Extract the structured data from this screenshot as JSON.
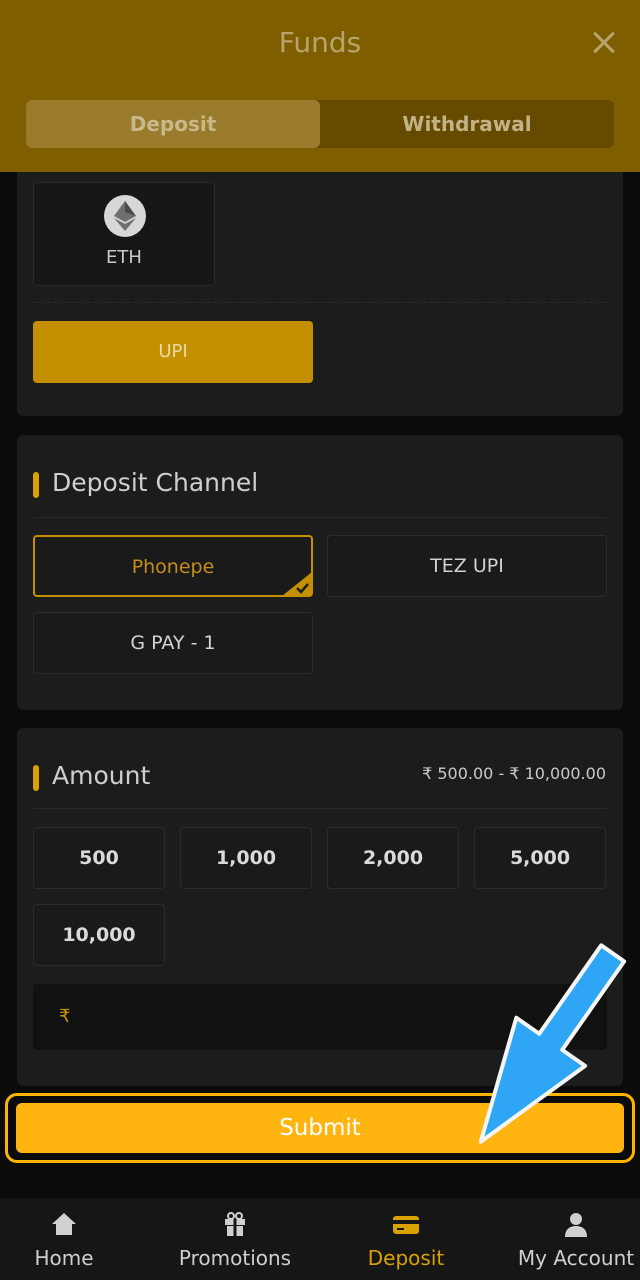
{
  "header": {
    "title": "Funds",
    "tabs": [
      {
        "label": "Deposit",
        "active": true
      },
      {
        "label": "Withdrawal",
        "active": false
      }
    ]
  },
  "payment_methods": {
    "crypto": {
      "label": "ETH",
      "icon": "ethereum-icon"
    },
    "upi_label": "UPI"
  },
  "deposit_channel": {
    "title": "Deposit Channel",
    "options": [
      {
        "label": "Phonepe",
        "selected": true
      },
      {
        "label": "TEZ UPI",
        "selected": false
      },
      {
        "label": "G PAY - 1",
        "selected": false
      }
    ]
  },
  "amount": {
    "title": "Amount",
    "range": "₹ 500.00 - ₹ 10,000.00",
    "presets": [
      "500",
      "1,000",
      "2,000",
      "5,000",
      "10,000"
    ],
    "currency_symbol": "₹",
    "input_value": ""
  },
  "submit_label": "Submit",
  "bottom_nav": [
    {
      "label": "Home",
      "icon": "home-icon",
      "active": false
    },
    {
      "label": "Promotions",
      "icon": "gift-icon",
      "active": false
    },
    {
      "label": "Deposit",
      "icon": "wallet-card-icon",
      "active": true
    },
    {
      "label": "My Account",
      "icon": "user-icon",
      "active": false
    }
  ],
  "colors": {
    "header_bg": "#7f5e00",
    "accent": "#ffb40f",
    "selected_border": "#c49000",
    "arrow": "#2ea6f5"
  }
}
